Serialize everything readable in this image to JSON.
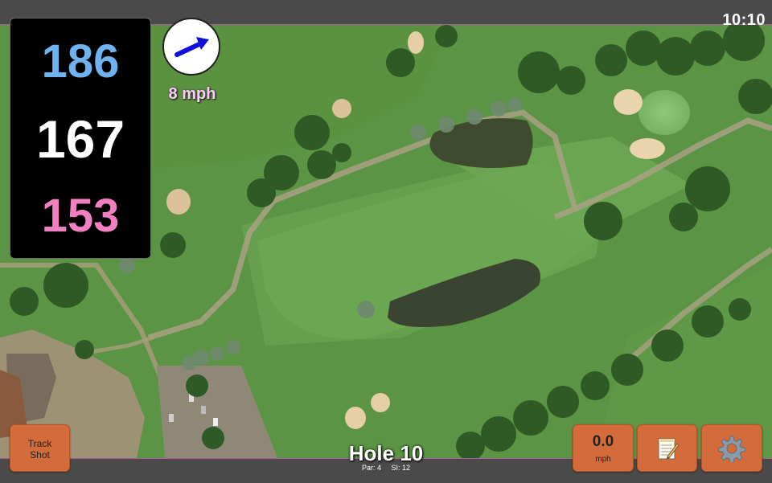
{
  "status": {
    "time": "10:10"
  },
  "yardages": {
    "back": "186",
    "middle": "167",
    "front": "153"
  },
  "wind": {
    "speed_label": "8 mph",
    "arrow_icon": "arrow-right-icon"
  },
  "hole": {
    "title": "Hole 10",
    "par_label": "Par: 4",
    "si_label": "SI: 12"
  },
  "buttons": {
    "track_shot_label": "Track\nShot",
    "speed_value": "0.0",
    "speed_unit": "mph",
    "notes_icon": "notepad-icon",
    "settings_icon": "gear-icon"
  },
  "colors": {
    "button_orange": "#d36b3b",
    "back_yardage": "#6fb2f0",
    "middle_yardage": "#ffffff",
    "front_yardage": "#f080c0",
    "wind_arrow": "#1010e0",
    "bar_border": "#b05aa0"
  }
}
